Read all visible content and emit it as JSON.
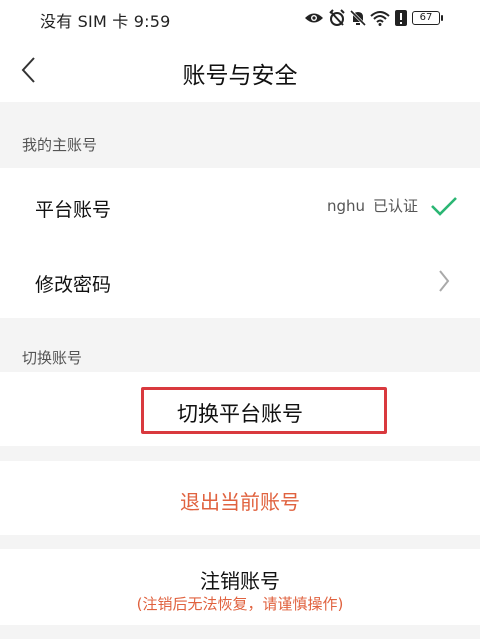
{
  "status_bar": {
    "carrier_time": "没有 SIM 卡 9:59",
    "battery": "67",
    "icons": [
      "eye-icon",
      "alarm-mute-icon",
      "bell-mute-icon",
      "wifi-icon",
      "alert-icon",
      "battery-icon"
    ]
  },
  "header": {
    "title": "账号与安全",
    "back_icon": "chevron-left-icon"
  },
  "main_account_section": {
    "label": "我的主账号",
    "rows": [
      {
        "label": "平台账号",
        "account": "nghu",
        "status": "已认证",
        "status_icon": "check-icon"
      },
      {
        "label": "修改密码",
        "trailing_icon": "chevron-right-icon"
      }
    ]
  },
  "switch_section": {
    "label": "切换账号",
    "button_label": "切换平台账号"
  },
  "logout": {
    "label": "退出当前账号"
  },
  "cancel_account": {
    "label": "注销账号",
    "note": "(注销后无法恢复，请谨慎操作)"
  },
  "colors": {
    "accent_green": "#2bb673",
    "warning_orange": "#e0623f",
    "highlight_red": "#d9393e",
    "page_background": "#f4f4f4"
  }
}
